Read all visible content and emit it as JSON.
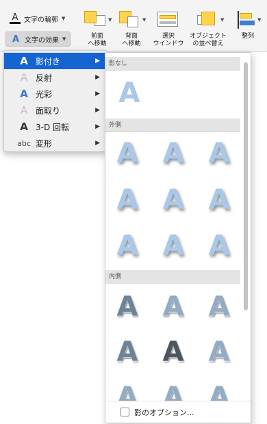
{
  "ribbon": {
    "text_outline_label": "文字の輪郭",
    "text_effect_label": "文字の効果",
    "tools": [
      {
        "line1": "前面",
        "line2": "へ移動"
      },
      {
        "line1": "背面",
        "line2": "へ移動"
      },
      {
        "line1": "選択",
        "line2": "ウインドウ"
      },
      {
        "line1": "オブジェクト",
        "line2": "の並べ替え"
      },
      {
        "line1": "整列",
        "line2": ""
      }
    ],
    "accent_color": "#ffd34d"
  },
  "menu": {
    "items": [
      {
        "label": "影付き",
        "icon": "A",
        "active": true
      },
      {
        "label": "反射",
        "icon": "A",
        "active": false
      },
      {
        "label": "光彩",
        "icon": "A",
        "active": false
      },
      {
        "label": "面取り",
        "icon": "A",
        "active": false
      },
      {
        "label": "3-D 回転",
        "icon": "A",
        "active": false
      },
      {
        "label": "変形",
        "icon": "abc",
        "active": false
      }
    ],
    "arrow": "▶",
    "active_color": "#1464d2"
  },
  "gallery": {
    "sections": [
      "影なし",
      "外側",
      "内側"
    ],
    "glyph": "A",
    "options_label": "影のオプション..."
  }
}
